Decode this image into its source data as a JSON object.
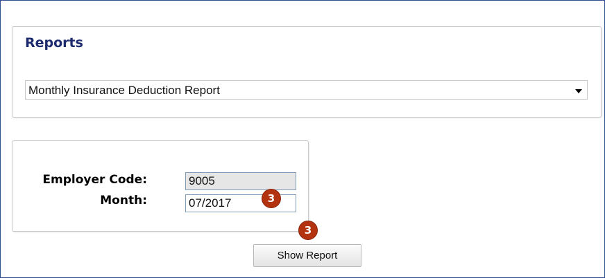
{
  "reports": {
    "title": "Reports",
    "selected_report": "Monthly Insurance Deduction Report"
  },
  "parameters": {
    "employer_code_label": "Employer Code:",
    "employer_code_value": "9005",
    "month_label": "Month:",
    "month_value": "07/2017"
  },
  "callouts": {
    "month": "3",
    "button": "3"
  },
  "actions": {
    "show_report_label": "Show Report"
  },
  "colors": {
    "title": "#1d2a6e",
    "callout": "#b3320f",
    "frame_border": "#2b4f8c"
  }
}
